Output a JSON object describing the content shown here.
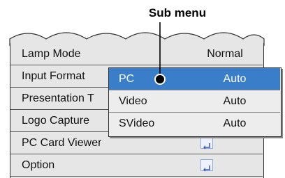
{
  "annotation": {
    "label": "Sub menu"
  },
  "main_menu": {
    "items": [
      {
        "label": "Lamp Mode",
        "value": "Normal"
      },
      {
        "label": "Input Format",
        "value": ""
      },
      {
        "label": "Presentation T",
        "value": ""
      },
      {
        "label": "Logo Capture",
        "value": ""
      },
      {
        "label": "PC Card Viewer",
        "value": "",
        "icon": "enter-icon"
      },
      {
        "label": "Option",
        "value": "",
        "icon": "enter-icon"
      }
    ]
  },
  "sub_menu": {
    "items": [
      {
        "label": "PC",
        "value": "Auto",
        "selected": true
      },
      {
        "label": "Video",
        "value": "Auto",
        "selected": false
      },
      {
        "label": "SVideo",
        "value": "Auto",
        "selected": false
      }
    ]
  },
  "colors": {
    "selected_bg": "#3a7dc9",
    "menu_bg": "#e6e6e6",
    "enter_icon": "#3a5cc0"
  }
}
